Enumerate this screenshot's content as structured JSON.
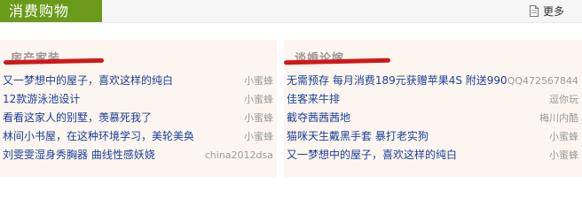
{
  "header": {
    "title": "消费购物",
    "more_label": "更多",
    "accent_color": "#6a9a1a",
    "more_icon": "document-icon"
  },
  "sections": {
    "left": {
      "title": "房产家装",
      "items": [
        {
          "title": "又一梦想中的屋子，喜欢这样的纯白",
          "author": "小蜜蜂"
        },
        {
          "title": "12款游泳池设计",
          "author": "小蜜蜂"
        },
        {
          "title": "看看这家人的别墅，羡慕死我了",
          "author": "小蜜蜂"
        },
        {
          "title": "林间小书屋，在这种环境学习，美轮美奂",
          "author": "小蜜蜂"
        },
        {
          "title": "刘雯雯湿身秀胸器 曲线性感妖娆",
          "author": "china2012dsa"
        }
      ]
    },
    "right": {
      "title": "谈婚论嫁",
      "items": [
        {
          "title": "无需预存 每月消费189元获赠苹果4S 附送990",
          "author": "QQ472567844"
        },
        {
          "title": "佳客来牛排",
          "author": "逗你玩"
        },
        {
          "title": "截夺茜茜茜地",
          "author": "梅川内酷"
        },
        {
          "title": "猫咪天生戴黑手套 暴打老实狗",
          "author": "小蜜蜂"
        },
        {
          "title": "又一梦想中的屋子，喜欢这样的纯白",
          "author": "小蜜蜂"
        }
      ]
    }
  }
}
